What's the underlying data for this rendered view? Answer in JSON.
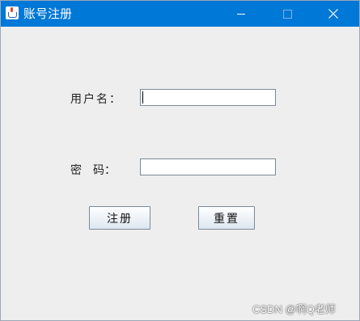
{
  "window": {
    "title": "账号注册",
    "accent": "#0078d7"
  },
  "controls": {
    "minimize_icon": "minimize-icon",
    "maximize_icon": "maximize-icon",
    "close_icon": "close-icon"
  },
  "form": {
    "username_label": "用户名：",
    "password_label": "密　码：",
    "username_value": "",
    "password_value": ""
  },
  "buttons": {
    "register": "注册",
    "reset": "重置"
  },
  "watermark": "CSDN @啊Q老师"
}
